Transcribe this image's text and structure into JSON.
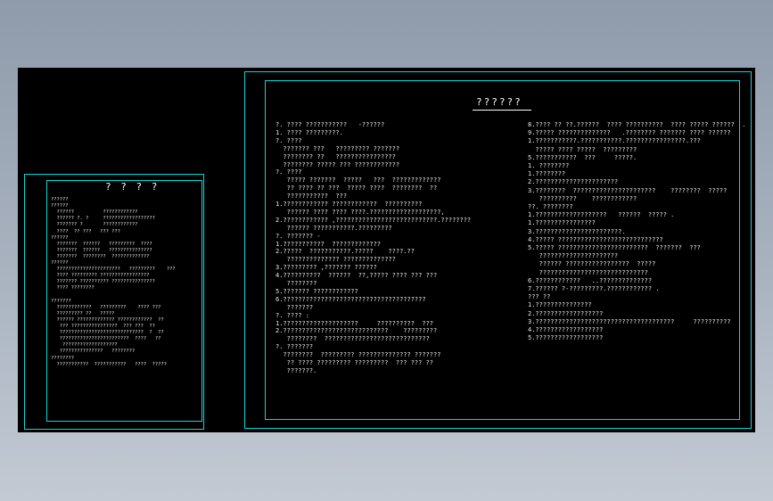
{
  "colors": {
    "background": "#000000",
    "frame": "#17d3d6",
    "text": "#e9e9e9",
    "accent_green": "#8fe04a",
    "accent_yellow": "#f2e15a"
  },
  "left_sheet": {
    "title": "? ? ? ?",
    "lines": [
      "??????",
      "??????",
      "  ??????          ????????????",
      "  ?????? ?. ?     ??????????????????",
      "  ??????? ?       ????????????",
      "  ????  ?? ???   ??? ???",
      "??????",
      "  ???????  ??????   ?????????  ????",
      "  ???????  ??????   ???????????????",
      "  ???????  ????????  ?????????????",
      "??????",
      "  ??????????????????????   ?????????    ???",
      "  ???? ????????? ?????????????????",
      "  ??????? ?????????? ???????????????",
      "  ???? ????????",
      "",
      "???????",
      "  ????????????   ?????????    ???? ???",
      "  ????????? ??   ?????",
      "  ?????? ????????????? ????????????  ??",
      "   ??? ????????????????  ??? ???  ??",
      "   ?????????????????????????????  ?  ??",
      "   ????????????????????????  ????   ??",
      "    ???????????????????",
      "   ???????????????   ????????",
      "????????",
      "  ???????????  ???????????   ????  ?????"
    ]
  },
  "right_sheet": {
    "title": "??????",
    "col1": [
      "?. ???? ???????????   -??????",
      "1. ???? ?????????.",
      "?. ????",
      "  ??????? ???   ????????? ???????",
      "  ???????? ??   ????????????????",
      "  ???????? ????? ??? ????????????",
      "?. ????",
      "   ????? ???????  ?????   ???  ?????????????",
      "   ?? ???? ?? ???  ????? ????  ????????  ??",
      "   ???????????  ???",
      "1.???????????? ????????????  ??????????",
      "   ?????? ???? ???? ????.???????????????????,",
      "2.???????????? ,???????????????????????????.????????",
      "   ?????? ???????????.?????????",
      "?. ??????? -",
      "1.???????????  ?????????????",
      "2.?????  ???????????.?????    ????.??",
      "   ?????????????? ??????????????",
      "3.????????? ,??????? ??????",
      "4.??????????  ??????  ??,????? ???? ??? ???",
      "   ????????",
      "5.??????? ????????????",
      "6.??????????????????????????????????????",
      "   ???????",
      "?. ???? :",
      "1.????????????????????     ??????????  ???",
      "2.????????????????????????????    ?????????",
      "   ????????  ????????????????????????????",
      "?. ???????",
      "  ????????  ????????? ?????????????? ???????",
      "   ?? ???? ????????? ?????????  ??? ??? ??",
      "   ???????."
    ],
    "col2": [
      "8.???? ?? ??.??????  ???? ??????????  ???? ????? ??????  .",
      "9.????? ??????????????   .???????? ??????? ???? ??????",
      "1.???????????.???????????.????????????????.???",
      "  ????? ???? ?????  ?????????",
      "5.???????????  ???     ?????.",
      "1. ????????",
      "1.????????",
      "2.??????????????????????",
      "3.????????  ??????????????????????    ????????  ?????",
      "   ??????????    ????????????",
      "??. ????????",
      "1.???????????????????   ??????  ????? .",
      "1.????????????????",
      "3.???????????????????????.",
      "4.????? ????????????????????????????",
      "5.????? ????????????????????????  ???????  ???",
      "   ?????????????????????",
      "   ?????? ?????????????????  ?????",
      "   ?????????????????????????????",
      "6.????????????   ..??????????????",
      "7.?????? ?-?????????.???????????? .",
      "??? ??",
      "1.???????????????",
      "2.??????????????????",
      "3.?????????????????????????????????????     ??????????",
      "4.??????????????????",
      "5.??????????????????"
    ]
  }
}
